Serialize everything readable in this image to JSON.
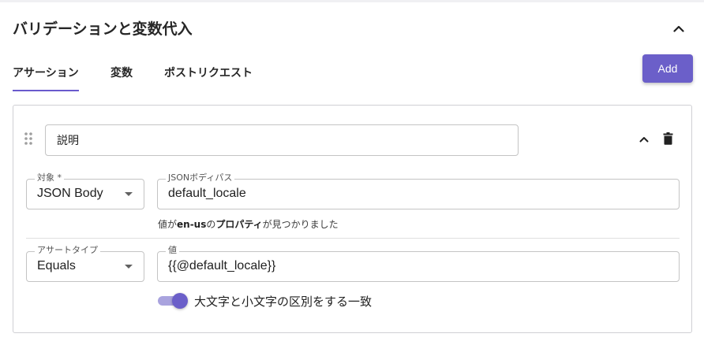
{
  "section": {
    "title": "バリデーションと変数代入",
    "collapse_icon": "chevron-up-icon"
  },
  "tabs": [
    {
      "label": "アサーション",
      "active": true
    },
    {
      "label": "変数",
      "active": false
    },
    {
      "label": "ポストリクエスト",
      "active": false
    }
  ],
  "add_button": {
    "label": "Add"
  },
  "colors": {
    "accent": "#6b5fc9",
    "border": "#c4c4c4"
  },
  "assertion": {
    "description": {
      "value": "説明"
    },
    "target": {
      "label": "対象 *",
      "value": "JSON Body"
    },
    "json_path": {
      "label": "JSONボディパス",
      "value": "default_locale"
    },
    "helper": {
      "prefix": "値が",
      "value": "en-us",
      "middle": "の",
      "property": "プロパティ",
      "suffix": "が見つかりました"
    },
    "assert_type": {
      "label": "アサートタイプ",
      "value": "Equals"
    },
    "expected": {
      "label": "値",
      "value": "{{@default_locale}}"
    },
    "case_toggle": {
      "label": "大文字と小文字の区別をする一致",
      "on": true
    }
  }
}
